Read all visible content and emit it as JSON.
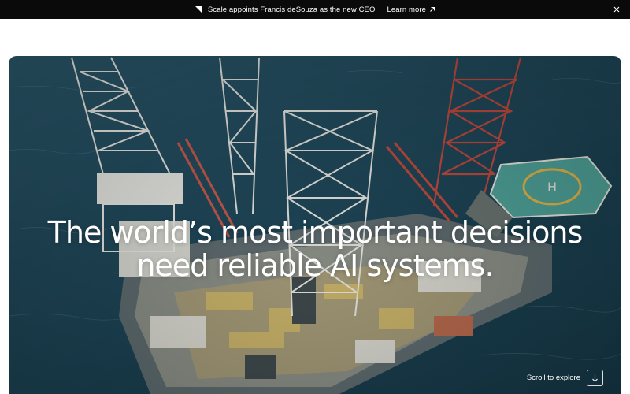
{
  "announcement": {
    "icon": "arrow-icon",
    "text": "Scale appoints Francis deSouza as the new CEO",
    "link_label": "Learn more",
    "link_icon": "arrow-up-right-icon",
    "close_icon": "close-icon"
  },
  "hero": {
    "image_subject": "aerial view of offshore oil rig with helipad at sea",
    "headline_line1": "The world’s most important decisions",
    "headline_line2": "need reliable AI systems.",
    "helipad_text": "H",
    "scroll_label": "Scroll to explore",
    "scroll_icon": "arrow-down-icon"
  },
  "colors": {
    "announcement_bg": "#0a0a0a",
    "sea": "#214a5c",
    "helipad": "#4fa39a"
  }
}
